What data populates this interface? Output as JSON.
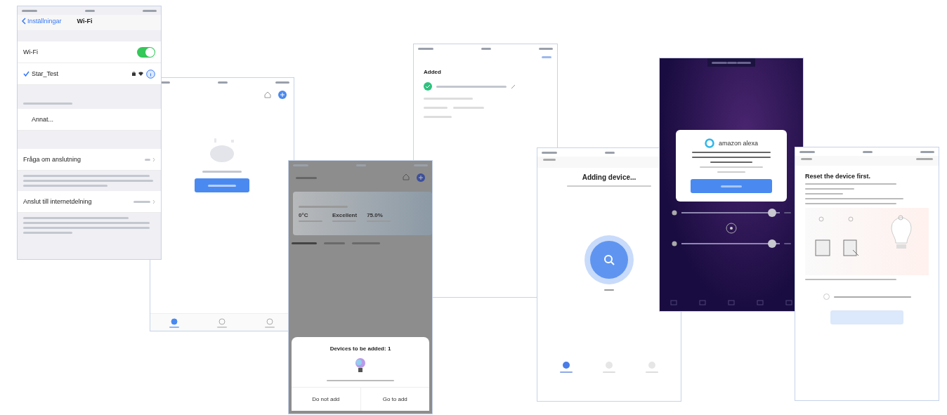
{
  "screens": [
    {
      "kind": "wifi_settings",
      "back": "Inställningar",
      "title": "Wi-Fi",
      "wifi": {
        "label": "Wi-Fi",
        "on": true
      },
      "network": {
        "name": "Star_Test",
        "selected": true
      },
      "other": "Annat...",
      "ask": "Fråga om anslutning",
      "hotspot": "Anslut till internetdelning"
    },
    {
      "kind": "home_empty",
      "tabs": [
        {
          "selected": true
        },
        {
          "selected": false
        },
        {
          "selected": false
        }
      ]
    },
    {
      "kind": "home_popup",
      "stats": [
        "0°C",
        "Excellent",
        "75.0%"
      ],
      "sheet": {
        "title": "Devices to be added: 1",
        "buttons": [
          "Do not add",
          "Go to add"
        ]
      }
    },
    {
      "kind": "added",
      "heading": "Added",
      "device": {
        "checked": true
      }
    },
    {
      "kind": "adding",
      "title": "Adding device...",
      "steps": [
        {
          "selected": true
        },
        {
          "selected": false
        },
        {
          "selected": false
        }
      ]
    },
    {
      "kind": "alexa",
      "brand": "amazon alexa",
      "sliders": [
        {
          "level": 0.92
        },
        {
          "level": 0.92
        }
      ]
    },
    {
      "kind": "reset",
      "title": "Reset the device first.",
      "confirm": {
        "checked": false
      }
    }
  ]
}
